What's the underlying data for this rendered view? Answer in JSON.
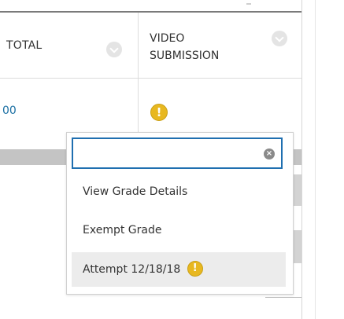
{
  "grid": {
    "columns": [
      {
        "label": "TOTAL"
      },
      {
        "label": "VIDEO SUBMISSION"
      }
    ],
    "row": {
      "total_value": "00",
      "video_status_icon": "exclamation-icon",
      "video_status_glyph": "!"
    }
  },
  "menu": {
    "search": {
      "value": "",
      "placeholder": ""
    },
    "clear_glyph": "×",
    "items": [
      {
        "label": "View Grade Details"
      },
      {
        "label": "Exempt Grade"
      },
      {
        "label": "Attempt 12/18/18",
        "icon": "exclamation-icon",
        "icon_glyph": "!"
      }
    ]
  },
  "colors": {
    "accent": "#1f6fb0",
    "link": "#1a6fa3",
    "warning": "#e8b820",
    "hover_row": "#ececec"
  }
}
